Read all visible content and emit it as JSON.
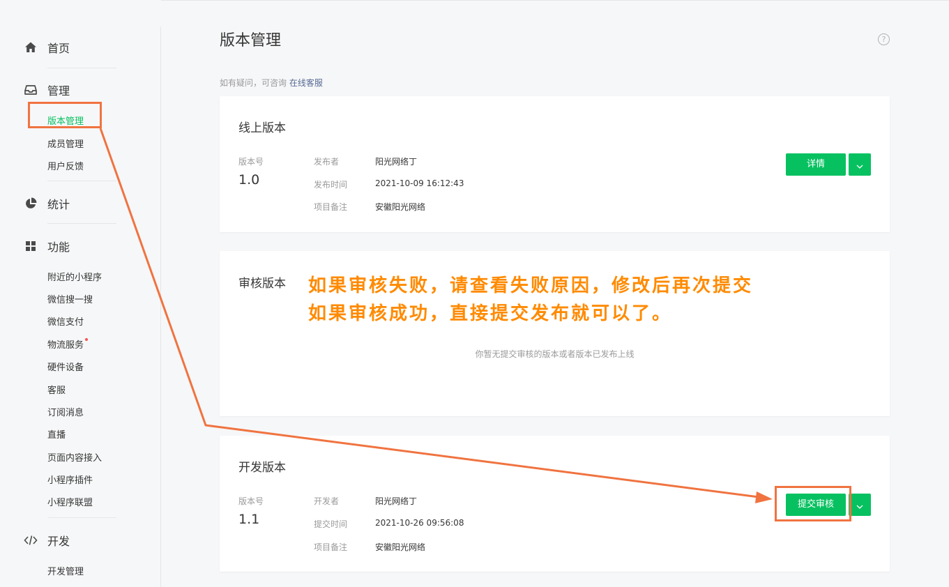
{
  "sidebar": {
    "home": {
      "label": "首页",
      "icon": "home-icon"
    },
    "manage": {
      "label": "管理",
      "icon": "inbox-icon",
      "items": [
        {
          "label": "版本管理",
          "active": true
        },
        {
          "label": "成员管理"
        },
        {
          "label": "用户反馈"
        }
      ]
    },
    "stats": {
      "label": "统计",
      "icon": "pie-chart-icon"
    },
    "features": {
      "label": "功能",
      "icon": "grid-icon",
      "items": [
        {
          "label": "附近的小程序"
        },
        {
          "label": "微信搜一搜"
        },
        {
          "label": "微信支付"
        },
        {
          "label": "物流服务",
          "badge": "red-dot"
        },
        {
          "label": "硬件设备"
        },
        {
          "label": "客服"
        },
        {
          "label": "订阅消息"
        },
        {
          "label": "直播"
        },
        {
          "label": "页面内容接入"
        },
        {
          "label": "小程序插件"
        },
        {
          "label": "小程序联盟"
        }
      ]
    },
    "dev": {
      "label": "开发",
      "icon": "code-icon",
      "items": [
        {
          "label": "开发管理"
        }
      ]
    }
  },
  "header": {
    "title": "版本管理",
    "help_icon": "question-circle-icon",
    "help_glyph": "?",
    "hint_prefix": "如有疑问，可咨询",
    "hint_link": "在线客服"
  },
  "online": {
    "title": "线上版本",
    "version_label": "版本号",
    "version": "1.0",
    "fields": [
      {
        "key": "发布者",
        "value": "阳光网络丁"
      },
      {
        "key": "发布时间",
        "value": "2021-10-09 16:12:43"
      },
      {
        "key": "项目备注",
        "value": "安徽阳光网络"
      }
    ],
    "button": "详情"
  },
  "review": {
    "title": "审核版本",
    "empty": "你暂无提交审核的版本或者版本已发布上线"
  },
  "dev_version": {
    "title": "开发版本",
    "version_label": "版本号",
    "version": "1.1",
    "fields": [
      {
        "key": "开发者",
        "value": "阳光网络丁"
      },
      {
        "key": "提交时间",
        "value": "2021-10-26 09:56:08"
      },
      {
        "key": "项目备注",
        "value": "安徽阳光网络"
      }
    ],
    "button": "提交审核"
  },
  "annotation": {
    "line1": "如果审核失败，请查看失败原因，修改后再次提交",
    "line2": "如果审核成功，直接提交发布就可以了。"
  },
  "colors": {
    "brand": "#07c160",
    "annotation_text": "#ff8a00",
    "highlight": "#f07340",
    "link": "#576b95"
  }
}
